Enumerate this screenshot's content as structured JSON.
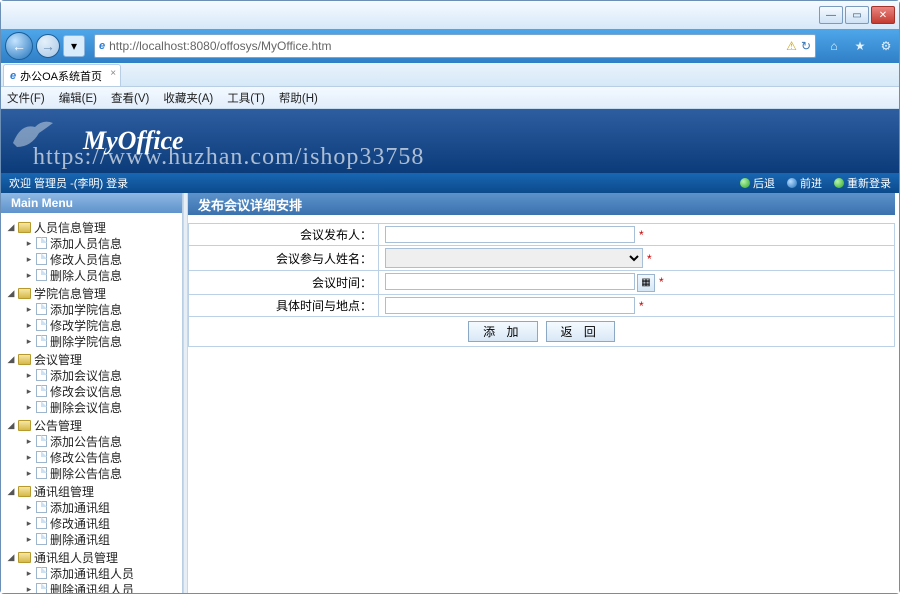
{
  "url": "http://localhost:8080/offosys/MyOffice.htm",
  "tab_title": "办公OA系统首页",
  "menubar": [
    "文件(F)",
    "编辑(E)",
    "查看(V)",
    "收藏夹(A)",
    "工具(T)",
    "帮助(H)"
  ],
  "banner": {
    "logo": "MyOffice",
    "watermark": "https://www.huzhan.com/ishop33758"
  },
  "userbar": {
    "welcome": "欢迎 管理员 -(李明) 登录",
    "actions": {
      "back": "后退",
      "forward": "前进",
      "relogin": "重新登录"
    }
  },
  "sidebar": {
    "title": "Main Menu",
    "groups": [
      {
        "label": "人员信息管理",
        "items": [
          "添加人员信息",
          "修改人员信息",
          "删除人员信息"
        ]
      },
      {
        "label": "学院信息管理",
        "items": [
          "添加学院信息",
          "修改学院信息",
          "删除学院信息"
        ]
      },
      {
        "label": "会议管理",
        "items": [
          "添加会议信息",
          "修改会议信息",
          "删除会议信息"
        ]
      },
      {
        "label": "公告管理",
        "items": [
          "添加公告信息",
          "修改公告信息",
          "删除公告信息"
        ]
      },
      {
        "label": "通讯组管理",
        "items": [
          "添加通讯组",
          "修改通讯组",
          "删除通讯组"
        ]
      },
      {
        "label": "通讯组人员管理",
        "items": [
          "添加通讯组人员",
          "删除通讯组人员"
        ]
      }
    ]
  },
  "content": {
    "title": "发布会议详细安排",
    "rows": [
      {
        "label": "会议发布人：",
        "type": "text",
        "required": true
      },
      {
        "label": "会议参与人姓名：",
        "type": "select",
        "required": true
      },
      {
        "label": "会议时间：",
        "type": "date",
        "required": true
      },
      {
        "label": "具体时间与地点：",
        "type": "text",
        "required": true
      }
    ],
    "buttons": {
      "add": "添 加",
      "back": "返 回"
    }
  }
}
